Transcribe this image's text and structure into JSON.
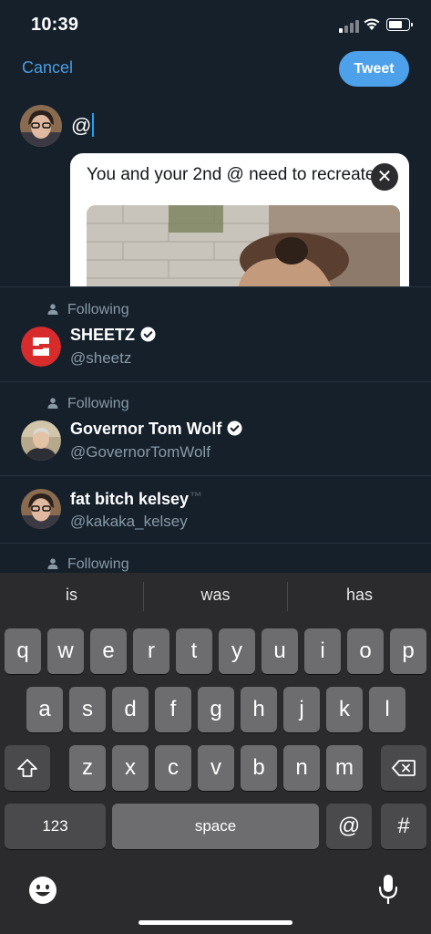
{
  "status": {
    "time": "10:39"
  },
  "header": {
    "cancel_label": "Cancel",
    "tweet_label": "Tweet"
  },
  "composer": {
    "text": "@"
  },
  "quote_card": {
    "text": "You and your 2nd @ need to recreate",
    "close_glyph": "✕"
  },
  "suggestions": [
    {
      "following_label": "Following",
      "name": "SHEETZ",
      "handle": "@sheetz",
      "verified": true
    },
    {
      "following_label": "Following",
      "name": "Governor Tom Wolf",
      "handle": "@GovernorTomWolf",
      "verified": true
    },
    {
      "name": "fat bitch kelsey",
      "name_suffix": "™",
      "handle": "@kakaka_kelsey",
      "verified": false
    },
    {
      "following_label": "Following"
    }
  ],
  "keyboard": {
    "predictions": [
      "is",
      "was",
      "has"
    ],
    "row1": [
      "q",
      "w",
      "e",
      "r",
      "t",
      "y",
      "u",
      "i",
      "o",
      "p"
    ],
    "row2": [
      "a",
      "s",
      "d",
      "f",
      "g",
      "h",
      "j",
      "k",
      "l"
    ],
    "row3": [
      "z",
      "x",
      "c",
      "v",
      "b",
      "n",
      "m"
    ],
    "numbers_label": "123",
    "space_label": "space",
    "at_label": "@",
    "hash_label": "#"
  },
  "icons": {
    "shift": "shift-icon",
    "backspace": "backspace-icon",
    "emoji": "emoji-icon",
    "mic": "microphone-icon"
  },
  "colors": {
    "accent": "#1da1f2",
    "background": "#15202b",
    "secondary_text": "#8899a6"
  }
}
